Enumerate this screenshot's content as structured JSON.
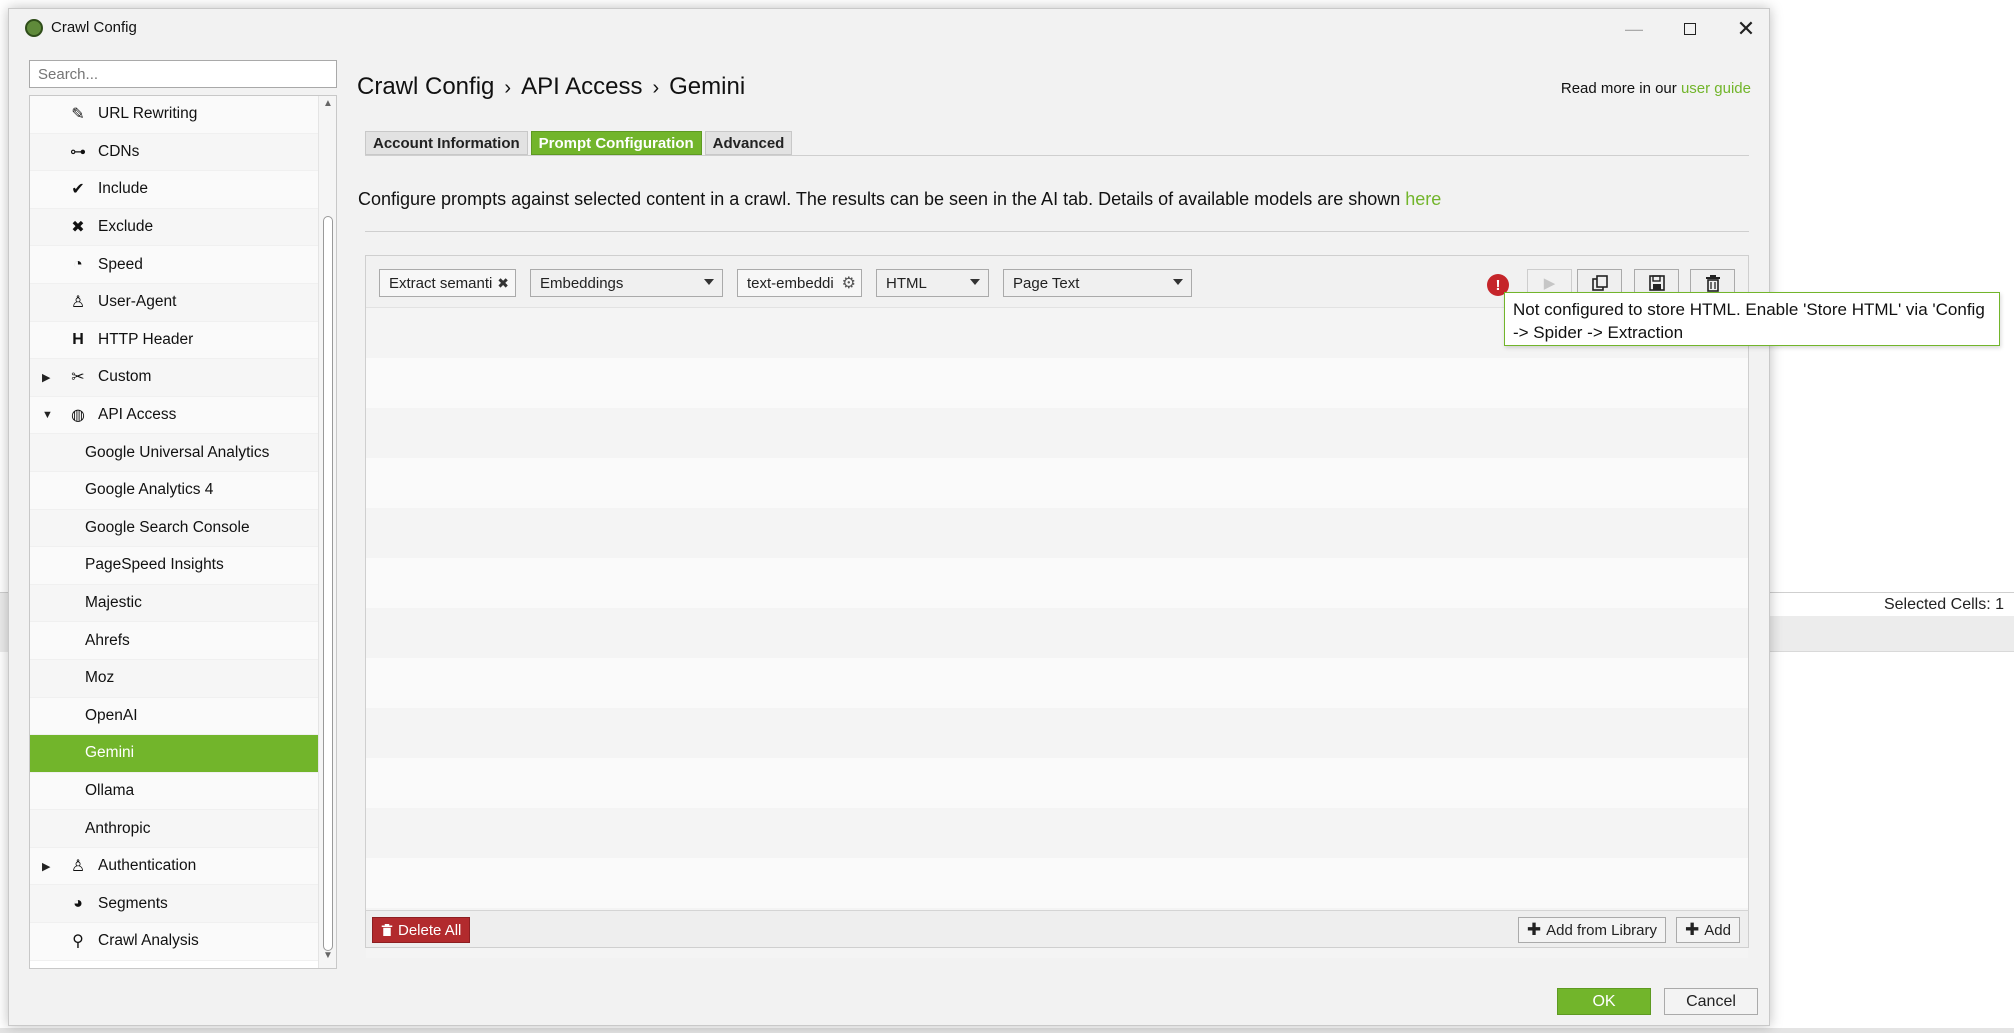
{
  "background": {
    "status_text": "Selected Cells:  1"
  },
  "window": {
    "title": "Crawl Config"
  },
  "colors": {
    "accent": "#72b52b",
    "danger": "#b22a2d",
    "warning": "#c5252a"
  },
  "sidebar": {
    "search_placeholder": "Search...",
    "items": [
      {
        "label": "URL Rewriting",
        "icon": "edit-icon",
        "level": 0
      },
      {
        "label": "CDNs",
        "icon": "network-icon",
        "level": 0
      },
      {
        "label": "Include",
        "icon": "check-circle-icon",
        "level": 0
      },
      {
        "label": "Exclude",
        "icon": "x-circle-icon",
        "level": 0
      },
      {
        "label": "Speed",
        "icon": "gauge-icon",
        "level": 0
      },
      {
        "label": "User-Agent",
        "icon": "user-agent-icon",
        "level": 0
      },
      {
        "label": "HTTP Header",
        "icon": "heading-icon",
        "level": 0
      },
      {
        "label": "Custom",
        "icon": "tools-icon",
        "level": 0,
        "expandable": true,
        "expanded": false
      },
      {
        "label": "API Access",
        "icon": "globe-icon",
        "level": 0,
        "expandable": true,
        "expanded": true
      },
      {
        "label": "Google Universal Analytics",
        "level": 1
      },
      {
        "label": "Google Analytics 4",
        "level": 1
      },
      {
        "label": "Google Search Console",
        "level": 1
      },
      {
        "label": "PageSpeed Insights",
        "level": 1
      },
      {
        "label": "Majestic",
        "level": 1
      },
      {
        "label": "Ahrefs",
        "level": 1
      },
      {
        "label": "Moz",
        "level": 1
      },
      {
        "label": "OpenAI",
        "level": 1
      },
      {
        "label": "Gemini",
        "level": 1,
        "selected": true
      },
      {
        "label": "Ollama",
        "level": 1
      },
      {
        "label": "Anthropic",
        "level": 1
      },
      {
        "label": "Authentication",
        "icon": "user-lock-icon",
        "level": 0,
        "expandable": true,
        "expanded": false
      },
      {
        "label": "Segments",
        "icon": "pie-chart-icon",
        "level": 0
      },
      {
        "label": "Crawl Analysis",
        "icon": "search-icon",
        "level": 0
      }
    ]
  },
  "header": {
    "breadcrumb": [
      "Crawl Config",
      "API Access",
      "Gemini"
    ],
    "separator": "›",
    "read_more_text": "Read more in our ",
    "read_more_link": "user guide"
  },
  "tabs": [
    {
      "label": "Account Information",
      "active": false
    },
    {
      "label": "Prompt Configuration",
      "active": true
    },
    {
      "label": "Advanced",
      "active": false
    }
  ],
  "description": {
    "text": "Configure prompts against selected content in a crawl. The results can be seen in the AI tab. Details of available models are shown ",
    "link": "here"
  },
  "prompt": {
    "name": "Extract semanti",
    "type": "Embeddings",
    "model": "text-embeddi",
    "format": "HTML",
    "content": "Page Text",
    "tooltip": "Not configured to store HTML. Enable 'Store HTML' via 'Config -> Spider -> Extraction"
  },
  "footer": {
    "delete_all": "Delete All",
    "add_from_library": "Add from Library",
    "add": "Add"
  },
  "dialog_buttons": {
    "ok": "OK",
    "cancel": "Cancel"
  }
}
